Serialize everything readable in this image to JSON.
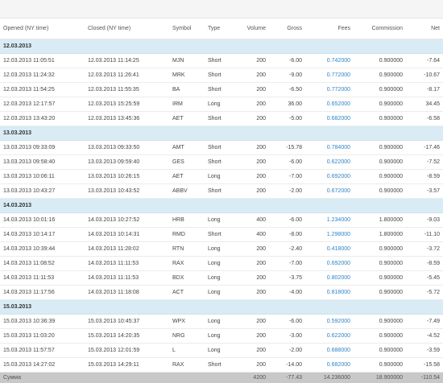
{
  "columns": {
    "opened": "Opened (NY time)",
    "closed": "Closed (NY time)",
    "symbol": "Symbol",
    "type": "Type",
    "volume": "Volume",
    "gross": "Gross",
    "fees": "Fees",
    "commission": "Commission",
    "net": "Net"
  },
  "groups": [
    {
      "date": "12.03.2013",
      "rows": [
        [
          "12.03.2013 11:05:51",
          "12.03.2013 11:14:25",
          "MJN",
          "Short",
          "200",
          "-6.00",
          "0.742000",
          "0.900000",
          "-7.64"
        ],
        [
          "12.03.2013 11:24:32",
          "12.03.2013 11:26:41",
          "MRK",
          "Short",
          "200",
          "-9.00",
          "0.772000",
          "0.900000",
          "-10.67"
        ],
        [
          "12.03.2013 11:54:25",
          "12.03.2013 11:55:35",
          "BA",
          "Short",
          "200",
          "-6.50",
          "0.772000",
          "0.900000",
          "-8.17"
        ],
        [
          "12.03.2013 12:17:57",
          "12.03.2013 15:25:59",
          "IRM",
          "Long",
          "200",
          "36.00",
          "0.652000",
          "0.900000",
          "34.45"
        ],
        [
          "12.03.2013 13:43:20",
          "12.03.2013 13:45:36",
          "AET",
          "Short",
          "200",
          "-5.00",
          "0.682000",
          "0.900000",
          "-6.58"
        ]
      ]
    },
    {
      "date": "13.03.2013",
      "rows": [
        [
          "13.03.2013 09:33:09",
          "13.03.2013 09:33:50",
          "AMT",
          "Short",
          "200",
          "-15.78",
          "0.784000",
          "0.900000",
          "-17.46"
        ],
        [
          "13.03.2013 09:58:40",
          "13.03.2013 09:59:40",
          "GES",
          "Short",
          "200",
          "-6.00",
          "0.622000",
          "0.900000",
          "-7.52"
        ],
        [
          "13.03.2013 10:06:11",
          "13.03.2013 10:26:15",
          "AET",
          "Long",
          "200",
          "-7.00",
          "0.692000",
          "0.900000",
          "-8.59"
        ],
        [
          "13.03.2013 10:43:27",
          "13.03.2013 10:43:52",
          "ABBV",
          "Short",
          "200",
          "-2.00",
          "0.672000",
          "0.900000",
          "-3.57"
        ]
      ]
    },
    {
      "date": "14.03.2013",
      "rows": [
        [
          "14.03.2013 10:01:16",
          "14.03.2013 10:27:52",
          "HRB",
          "Long",
          "400",
          "-6.00",
          "1.234000",
          "1.800000",
          "-9.03"
        ],
        [
          "14.03.2013 10:14:17",
          "14.03.2013 10:14:31",
          "RMD",
          "Short",
          "400",
          "-8.00",
          "1.298000",
          "1.800000",
          "-11.10"
        ],
        [
          "14.03.2013 10:39:44",
          "14.03.2013 11:28:02",
          "RTN",
          "Long",
          "200",
          "-2.40",
          "0.418000",
          "0.900000",
          "-3.72"
        ],
        [
          "14.03.2013 11:08:52",
          "14.03.2013 11:11:53",
          "RAX",
          "Long",
          "200",
          "-7.00",
          "0.692000",
          "0.900000",
          "-8.59"
        ],
        [
          "14.03.2013 11:11:53",
          "14.03.2013 11:11:53",
          "BDX",
          "Long",
          "200",
          "-3.75",
          "0.802000",
          "0.900000",
          "-5.45"
        ],
        [
          "14.03.2013 11:17:56",
          "14.03.2013 11:18:08",
          "ACT",
          "Long",
          "200",
          "-4.00",
          "0.818000",
          "0.900000",
          "-5.72"
        ]
      ]
    },
    {
      "date": "15.03.2013",
      "rows": [
        [
          "15.03.2013 10:36:39",
          "15.03.2013 10:45:37",
          "WPX",
          "Long",
          "200",
          "-6.00",
          "0.592000",
          "0.900000",
          "-7.49"
        ],
        [
          "15.03.2013 11:03:20",
          "15.03.2013 14:20:35",
          "NRG",
          "Long",
          "200",
          "-3.00",
          "0.622000",
          "0.900000",
          "-4.52"
        ],
        [
          "15.03.2013 11:57:57",
          "15.03.2013 12:01:59",
          "L",
          "Long",
          "200",
          "-2.00",
          "0.688000",
          "0.900000",
          "-3.59"
        ],
        [
          "15.03.2013 14:27:02",
          "15.03.2013 14:29:11",
          "RAX",
          "Short",
          "200",
          "-14.00",
          "0.682000",
          "0.900000",
          "-15.58"
        ]
      ]
    }
  ],
  "total": {
    "label": "Сумма",
    "volume": "4200",
    "gross": "-77.43",
    "fees": "14.236000",
    "commission": "18.900000",
    "net": "-110.54"
  }
}
